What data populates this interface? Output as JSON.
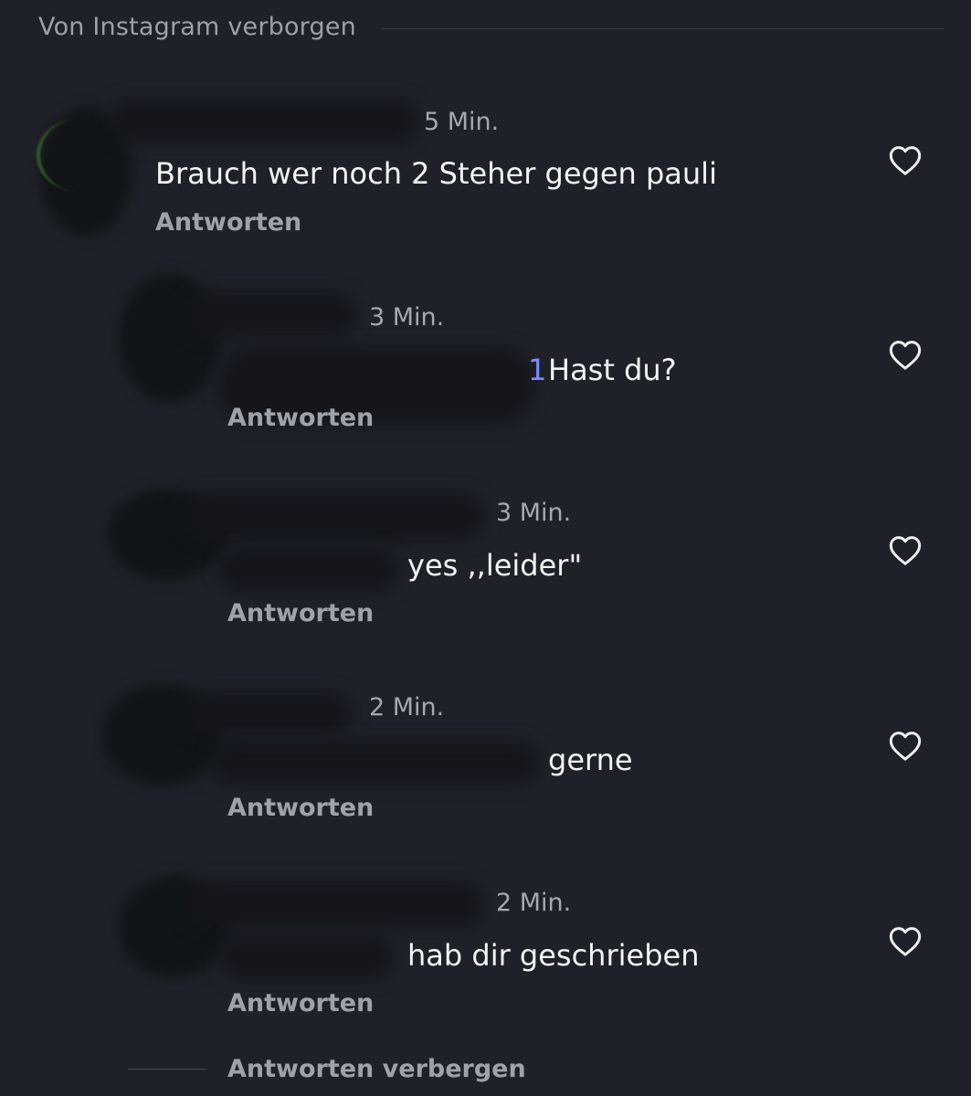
{
  "section": {
    "title": "Von Instagram verborgen"
  },
  "comments": [
    {
      "time": "5 Min.",
      "text": "Brauch wer noch 2 Steher gegen pauli",
      "reply_label": "Antworten"
    },
    {
      "time": "3 Min.",
      "text": "Hast du?",
      "reply_label": "Antworten"
    },
    {
      "time": "3 Min.",
      "text": "yes ,,leider\"",
      "reply_label": "Antworten"
    },
    {
      "time": "2 Min.",
      "text": "gerne",
      "reply_label": "Antworten"
    },
    {
      "time": "2 Min.",
      "text": "hab dir geschrieben",
      "reply_label": "Antworten"
    }
  ],
  "hide_replies_label": "Antworten verbergen",
  "icons": {
    "like": "heart-outline-icon"
  },
  "colors": {
    "background": "#202128",
    "text_primary": "#f3f3f5",
    "text_secondary": "#a0a2aa",
    "mention": "#7c8cff"
  }
}
